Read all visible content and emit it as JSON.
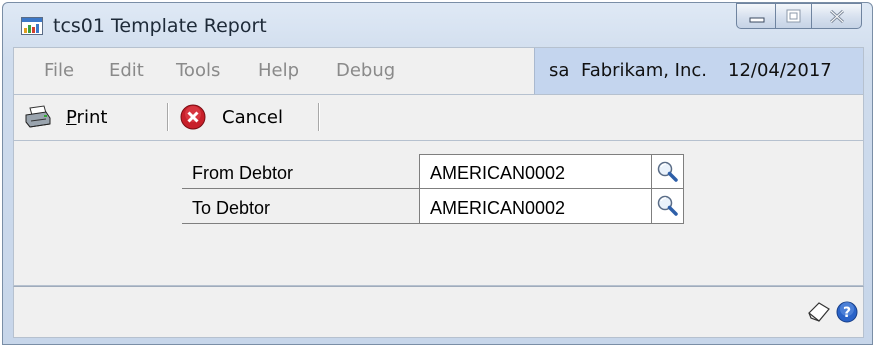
{
  "window": {
    "title": "tcs01 Template Report",
    "icon": "report-window-icon",
    "buttons": [
      "minimize-icon",
      "maximize-icon",
      "close-icon"
    ]
  },
  "menu": {
    "items": [
      {
        "label": "File"
      },
      {
        "label": "Edit"
      },
      {
        "label": "Tools"
      },
      {
        "label": "Help"
      },
      {
        "label": "Debug"
      }
    ],
    "user": "sa",
    "company": "Fabrikam, Inc.",
    "date": "12/04/2017"
  },
  "toolbar": {
    "print_label": "Print",
    "cancel_label": "Cancel",
    "print_icon": "printer-icon",
    "cancel_icon": "cancel-circle-icon"
  },
  "form": {
    "fields": [
      {
        "label": "From Debtor",
        "value": "AMERICAN0002",
        "lookup_icon": "magnifier-icon"
      },
      {
        "label": "To Debtor",
        "value": "AMERICAN0002",
        "lookup_icon": "magnifier-icon"
      }
    ]
  },
  "statusbar": {
    "icons": [
      "note-icon",
      "help-icon"
    ]
  },
  "colors": {
    "window_frame": "#c7d6ea",
    "userinfo_bg": "#c4d5ee",
    "menu_text_disabled": "#8a8a8a",
    "cancel_red": "#c8202a",
    "help_blue": "#2a63c8"
  }
}
